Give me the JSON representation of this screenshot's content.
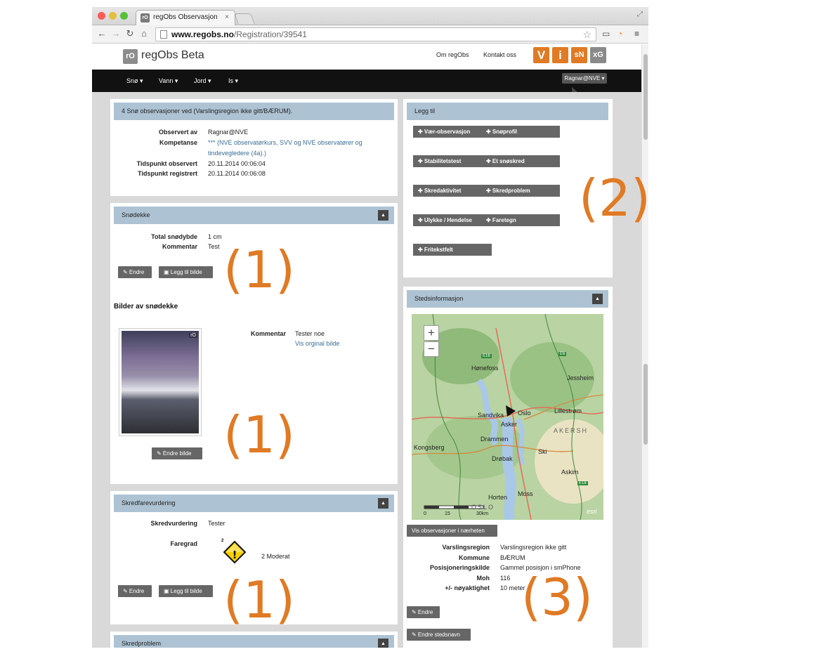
{
  "browser": {
    "tab_title": "regObs Observasjon",
    "tab_favicon": "rO",
    "close_glyph": "×",
    "url_domain": "www.regobs.no",
    "url_path": "/Registration/39541",
    "colors": {
      "red": "#fc5b57",
      "yellow": "#e5bf3c",
      "green": "#57c038"
    }
  },
  "site": {
    "logo": "rO",
    "title": "regObs Beta",
    "links": [
      "Om regObs",
      "Kontakt oss"
    ],
    "badges": [
      {
        "text": "V",
        "color": "#e07a24"
      },
      {
        "text": "i",
        "color": "#e07a24"
      },
      {
        "text": "sN",
        "color": "#e07a24"
      },
      {
        "text": "xG",
        "color": "#8a8a8a"
      }
    ]
  },
  "nav": {
    "items": [
      "Snø ▾",
      "Vann ▾",
      "Jord ▾",
      "Is ▾"
    ],
    "user": "Ragnar@NVE ▾"
  },
  "obs": {
    "title": "4 Snø observasjoner ved (Varslingsregion ikke gitt/BÆRUM).",
    "fields": [
      {
        "label": "Observert av",
        "value": "Ragnar@NVE"
      },
      {
        "label": "Kompetanse",
        "value": "*** (NVE observatørkurs, SVV og NVE observatører og"
      },
      {
        "label": "",
        "value": "tindevegledere (4a).)"
      },
      {
        "label": "Tidspunkt observert",
        "value": "20.11.2014 00:06:04"
      },
      {
        "label": "Tidspunkt registrert",
        "value": "20.11.2014 00:06:08"
      }
    ]
  },
  "snodekke": {
    "title": "Snødekke",
    "fields": [
      {
        "label": "Total snødybde",
        "value": "1 cm"
      },
      {
        "label": "Kommentar",
        "value": "Test"
      }
    ],
    "edit": "✎ Endre",
    "add_image": "▣ Legg til bilde",
    "images_heading": "Bilder av snødekke",
    "image_badge": "rO",
    "image_comment_label": "Kommentar",
    "image_comment": "Tester noe",
    "image_link": "Vis orginal bilde",
    "edit_image": "✎ Endre bilde"
  },
  "skredfare": {
    "title": "Skredfarevurdering",
    "fields": [
      {
        "label": "Skredvurdering",
        "value": "Tester"
      },
      {
        "label": "Faregrad",
        "value": ""
      }
    ],
    "level_small": "2",
    "level_text": "2 Moderat",
    "warning_mark": "!",
    "warning_color": "#f6d100",
    "edit": "✎ Endre",
    "add_image": "▣ Legg til bilde"
  },
  "skredproblem": {
    "title": "Skredproblem"
  },
  "legg_til": {
    "title": "Legg til",
    "rows": [
      [
        "✚ Vær-observasjon",
        "✚ Snøprofil"
      ],
      [
        "✚ Stabilitetstest",
        "✚ Et snøskred"
      ],
      [
        "✚ Skredaktivitet",
        "✚ Skredproblem"
      ],
      [
        "✚ Ulykke / Hendelse",
        "✚ Faretegn"
      ],
      [
        "✚ Fritekstfelt"
      ]
    ]
  },
  "sted": {
    "title": "Stedsinformasjon",
    "map_places": [
      "Hønefoss",
      "Jessheim",
      "Oslo",
      "Lillestrøm",
      "Sandvika",
      "Asker",
      "AKERSH",
      "Kongsberg",
      "Drammen",
      "Drøbak",
      "Ski",
      "Askim",
      "Horten",
      "Moss",
      "OSLO",
      "E16",
      "E18",
      "E6"
    ],
    "zoom_in": "+",
    "zoom_out": "−",
    "scale": [
      "0",
      "15",
      "30km"
    ],
    "map_more": "esri",
    "nearby_button": "Vis observasjoner i nærheten",
    "fields": [
      {
        "label": "Varslingsregion",
        "value": "Varslingsregion ikke gitt"
      },
      {
        "label": "Kommune",
        "value": "BÆRUM"
      },
      {
        "label": "Posisjoneringskilde",
        "value": "Gammel posisjon i smPhone"
      },
      {
        "label": "Moh",
        "value": "116"
      },
      {
        "label": "+/- nøyaktighet",
        "value": "10 meter"
      }
    ],
    "edit": "✎ Endre",
    "edit_name": "✎ Endre stedsnavn"
  },
  "annotations": [
    "(1)",
    "(1)",
    "(1)",
    "(2)",
    "(3)"
  ],
  "collapse_glyph": "▲"
}
